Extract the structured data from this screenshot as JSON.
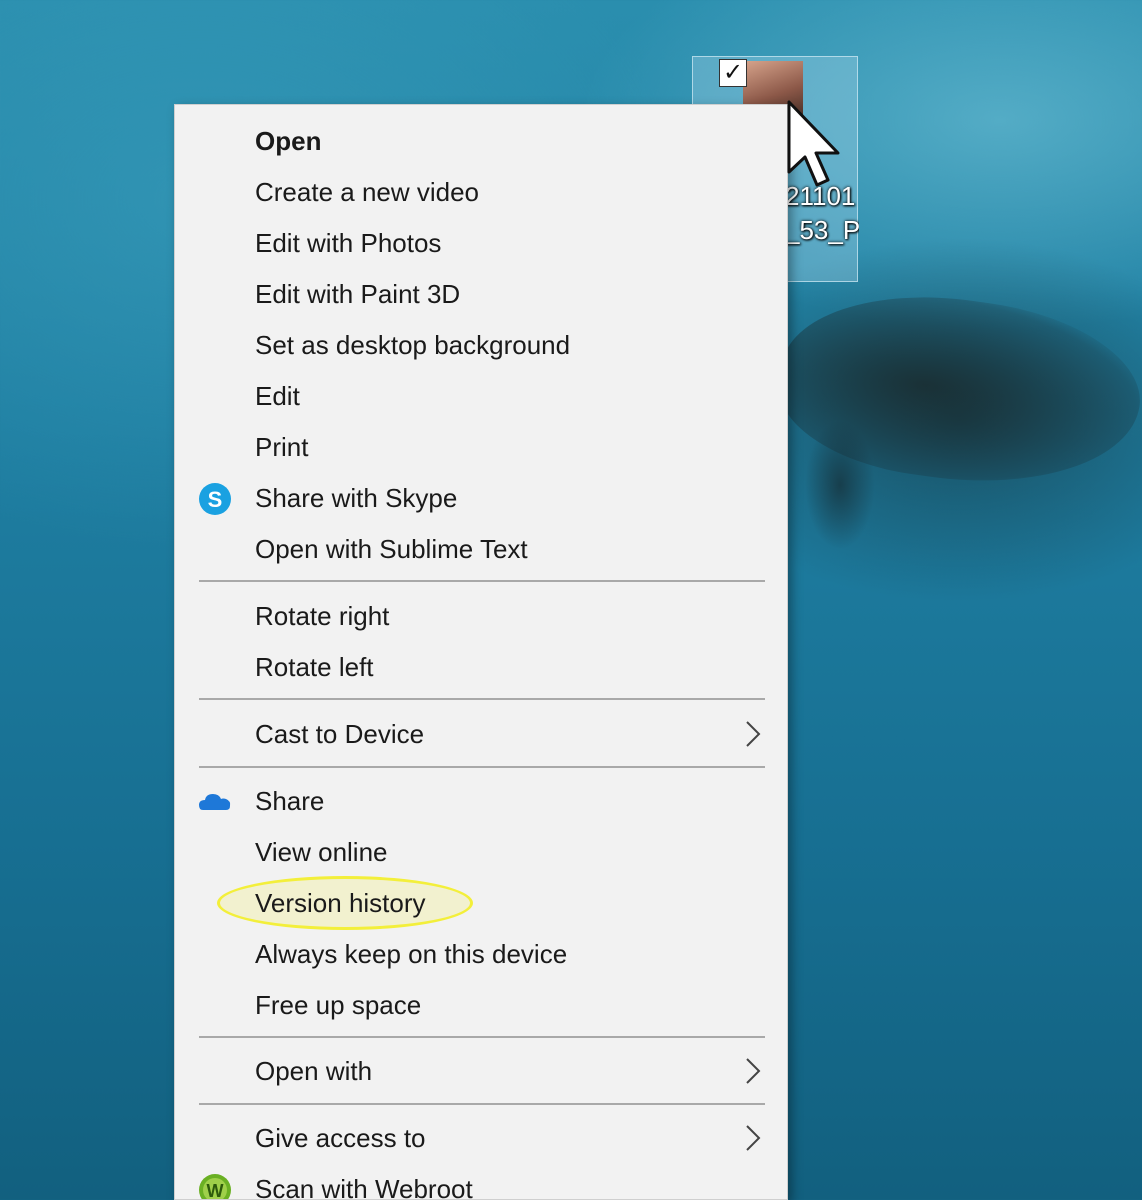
{
  "desktop_icon": {
    "label_line1": "21101",
    "label_line2": "_53_P",
    "checked": true,
    "check_glyph": "✓"
  },
  "context_menu": {
    "items": [
      {
        "label": "Open",
        "bold": true
      },
      {
        "label": "Create a new video"
      },
      {
        "label": "Edit with Photos"
      },
      {
        "label": "Edit with Paint 3D"
      },
      {
        "label": "Set as desktop background"
      },
      {
        "label": "Edit"
      },
      {
        "label": "Print"
      },
      {
        "label": "Share with Skype",
        "icon": "skype-icon"
      },
      {
        "label": "Open with Sublime Text"
      },
      {
        "label": "Rotate right"
      },
      {
        "label": "Rotate left"
      },
      {
        "label": "Cast to Device",
        "submenu": true
      },
      {
        "label": "Share",
        "icon": "onedrive-cloud-icon"
      },
      {
        "label": "View online"
      },
      {
        "label": "Version history",
        "highlighted": true
      },
      {
        "label": "Always keep on this device"
      },
      {
        "label": "Free up space"
      },
      {
        "label": "Open with",
        "submenu": true
      },
      {
        "label": "Give access to",
        "submenu": true
      },
      {
        "label": "Scan with Webroot",
        "icon": "webroot-icon"
      }
    ]
  },
  "icons": {
    "skype_glyph": "S",
    "webroot_glyph": "W"
  },
  "colors": {
    "menu_background": "#f2f2f2",
    "highlight": "#f3ef3a",
    "skype_blue": "#1aa1e1",
    "onedrive_blue": "#1e78d8",
    "webroot_green": "#6ab023"
  }
}
